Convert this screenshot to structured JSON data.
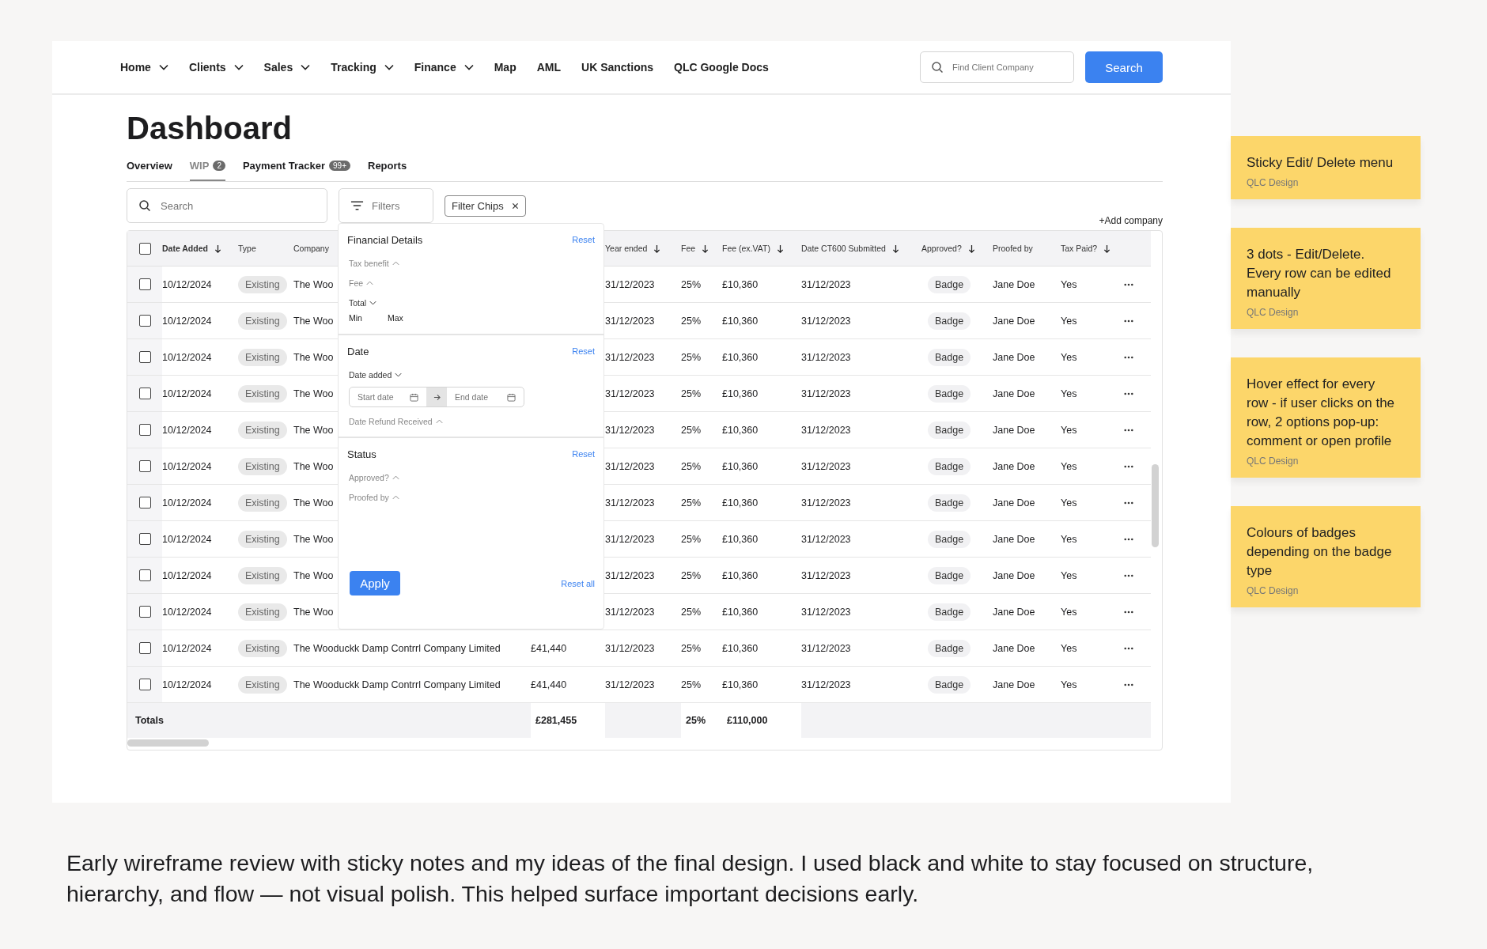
{
  "nav": {
    "items": [
      {
        "label": "Home",
        "dropdown": true
      },
      {
        "label": "Clients",
        "dropdown": true
      },
      {
        "label": "Sales",
        "dropdown": true
      },
      {
        "label": "Tracking",
        "dropdown": true
      },
      {
        "label": "Finance",
        "dropdown": true
      },
      {
        "label": "Map",
        "dropdown": false
      },
      {
        "label": "AML",
        "dropdown": false
      },
      {
        "label": "UK Sanctions",
        "dropdown": false
      },
      {
        "label": "QLC Google Docs",
        "dropdown": false
      }
    ],
    "search": {
      "placeholder": "Find Client Company"
    },
    "search_button": "Search"
  },
  "title": "Dashboard",
  "tabs": [
    {
      "label": "Overview",
      "selected": false
    },
    {
      "label": "WIP",
      "badge": "2",
      "selected": true
    },
    {
      "label": "Payment Tracker",
      "badge": "99+",
      "selected": false
    },
    {
      "label": "Reports",
      "selected": false
    }
  ],
  "toolbar": {
    "search": {
      "placeholder": "Search"
    },
    "filters": "Filters",
    "chips": [
      {
        "label": "Filter Chips"
      }
    ],
    "add": "+Add company"
  },
  "table": {
    "select_all": {
      "checked": false
    },
    "columns": [
      {
        "label": "Date Added",
        "sortable": true,
        "bold": true
      },
      {
        "label": "Type",
        "sortable": false,
        "bold": false
      },
      {
        "label": "Company",
        "sortable": false,
        "bold": false
      },
      null,
      {
        "label": "Year ended",
        "sortable": true,
        "bold": false
      },
      {
        "label": "Fee",
        "sortable": true,
        "bold": false
      },
      {
        "label": "Fee (ex.VAT)",
        "sortable": true,
        "bold": false
      },
      {
        "label": "Date CT600 Submitted",
        "sortable": true,
        "bold": false
      },
      {
        "label": "Approved?",
        "sortable": true,
        "bold": false
      },
      {
        "label": "Proofed by",
        "sortable": false,
        "bold": false
      },
      {
        "label": "Tax Paid?",
        "sortable": true,
        "bold": false
      }
    ],
    "rows": [
      {
        "checked": false,
        "cells": [
          "10/12/2024",
          "Existing",
          "The Woo",
          null,
          "31/12/2023",
          "25%",
          "£10,360",
          "31/12/2023",
          "Badge",
          "Jane Doe",
          "Yes"
        ]
      },
      {
        "checked": false,
        "cells": [
          "10/12/2024",
          "Existing",
          "The Woo",
          null,
          "31/12/2023",
          "25%",
          "£10,360",
          "31/12/2023",
          "Badge",
          "Jane Doe",
          "Yes"
        ]
      },
      {
        "checked": false,
        "cells": [
          "10/12/2024",
          "Existing",
          "The Woo",
          null,
          "31/12/2023",
          "25%",
          "£10,360",
          "31/12/2023",
          "Badge",
          "Jane Doe",
          "Yes"
        ]
      },
      {
        "checked": false,
        "cells": [
          "10/12/2024",
          "Existing",
          "The Woo",
          null,
          "31/12/2023",
          "25%",
          "£10,360",
          "31/12/2023",
          "Badge",
          "Jane Doe",
          "Yes"
        ]
      },
      {
        "checked": false,
        "cells": [
          "10/12/2024",
          "Existing",
          "The Woo",
          null,
          "31/12/2023",
          "25%",
          "£10,360",
          "31/12/2023",
          "Badge",
          "Jane Doe",
          "Yes"
        ]
      },
      {
        "checked": false,
        "cells": [
          "10/12/2024",
          "Existing",
          "The Woo",
          null,
          "31/12/2023",
          "25%",
          "£10,360",
          "31/12/2023",
          "Badge",
          "Jane Doe",
          "Yes"
        ]
      },
      {
        "checked": false,
        "cells": [
          "10/12/2024",
          "Existing",
          "The Woo",
          null,
          "31/12/2023",
          "25%",
          "£10,360",
          "31/12/2023",
          "Badge",
          "Jane Doe",
          "Yes"
        ]
      },
      {
        "checked": false,
        "cells": [
          "10/12/2024",
          "Existing",
          "The Woo",
          null,
          "31/12/2023",
          "25%",
          "£10,360",
          "31/12/2023",
          "Badge",
          "Jane Doe",
          "Yes"
        ]
      },
      {
        "checked": false,
        "cells": [
          "10/12/2024",
          "Existing",
          "The Woo",
          null,
          "31/12/2023",
          "25%",
          "£10,360",
          "31/12/2023",
          "Badge",
          "Jane Doe",
          "Yes"
        ]
      },
      {
        "checked": false,
        "cells": [
          "10/12/2024",
          "Existing",
          "The Woo",
          null,
          "31/12/2023",
          "25%",
          "£10,360",
          "31/12/2023",
          "Badge",
          "Jane Doe",
          "Yes"
        ]
      },
      {
        "checked": false,
        "cells": [
          "10/12/2024",
          "Existing",
          "The Wooduckk Damp Contrrl Company Limited",
          "£41,440",
          "31/12/2023",
          "25%",
          "£10,360",
          "31/12/2023",
          "Badge",
          "Jane Doe",
          "Yes"
        ]
      },
      {
        "checked": false,
        "cells": [
          "10/12/2024",
          "Existing",
          "The Wooduckk Damp Contrrl Company Limited",
          "£41,440",
          "31/12/2023",
          "25%",
          "£10,360",
          "31/12/2023",
          "Badge",
          "Jane Doe",
          "Yes"
        ]
      }
    ],
    "totals": {
      "label": "Totals",
      "total": "£281,455",
      "fee": "25%",
      "fee_ex_vat": "£110,000"
    }
  },
  "filter_panel": {
    "sections": [
      {
        "title": "Financial Details",
        "reset": "Reset",
        "items": [
          {
            "label": "Tax benefit",
            "expanded": false
          },
          {
            "label": "Fee",
            "expanded": false
          },
          {
            "label": "Total",
            "expanded": true,
            "min": "Min",
            "max": "Max"
          }
        ]
      },
      {
        "title": "Date",
        "reset": "Reset",
        "items": [
          {
            "label": "Date added",
            "expanded": true,
            "start": {
              "placeholder": "Start date"
            },
            "end": {
              "placeholder": "End date"
            }
          },
          {
            "label": "Date Refund Received",
            "expanded": false
          }
        ]
      },
      {
        "title": "Status",
        "reset": "Reset",
        "items": [
          {
            "label": "Approved?",
            "expanded": false
          },
          {
            "label": "Proofed by",
            "expanded": false
          }
        ]
      }
    ],
    "apply": "Apply",
    "reset_all": "Reset all"
  },
  "notes": [
    {
      "text": "Sticky Edit/ Delete menu",
      "author": "QLC Design"
    },
    {
      "text": "3 dots - Edit/Delete. Every row can be edited manually",
      "author": "QLC Design"
    },
    {
      "text": "Hover effect for every row - if user  clicks on the row, 2 options pop-up: comment or open profile",
      "author": "QLC Design"
    },
    {
      "text": "Colours of badges depending on the badge type",
      "author": "QLC Design"
    }
  ],
  "caption": "Early wireframe review with sticky notes and my ideas of the final design. I used black and white to stay focused on structure, hierarchy, and flow — not visual polish. This helped surface important decisions early."
}
